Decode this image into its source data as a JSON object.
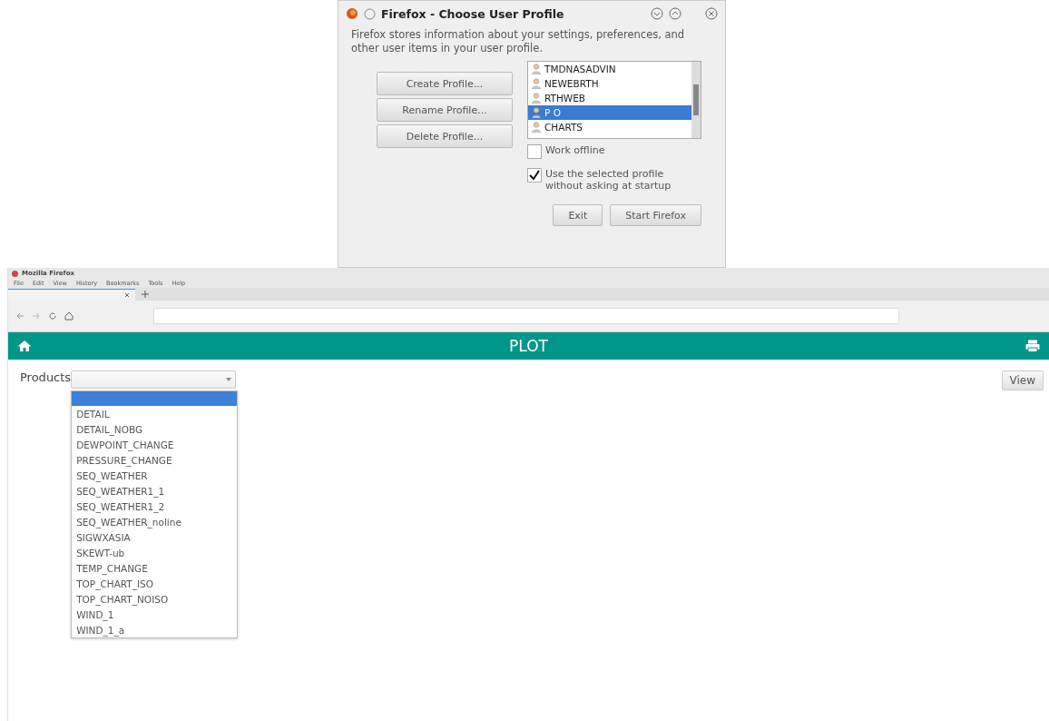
{
  "dialog": {
    "title": "Firefox - Choose User Profile",
    "message": "Firefox stores information about your settings, preferences, and other user items in your user profile.",
    "buttons": [
      "Create Profile...",
      "Rename Profile...",
      "Delete Profile..."
    ],
    "profiles": [
      {
        "name": "TMDNASADVIN",
        "selected": false
      },
      {
        "name": "NEWEBRTH",
        "selected": false
      },
      {
        "name": "RTHWEB",
        "selected": false
      },
      {
        "name": "P O",
        "selected": true
      },
      {
        "name": "CHARTS",
        "selected": false
      }
    ],
    "options": [
      {
        "label": "Work offline",
        "checked": false
      },
      {
        "label": "Use the selected profile without asking at startup",
        "checked": true
      }
    ],
    "footer_buttons": [
      "Exit",
      "Start Firefox"
    ]
  },
  "browser": {
    "title": "Mozilla Firefox",
    "menu": [
      "File",
      "Edit",
      "View",
      "History",
      "Bookmarks",
      "Tools",
      "Help"
    ]
  },
  "app": {
    "title": "PLOT",
    "products_label": "Products",
    "view_button": "View",
    "blank_option_selected": true,
    "products": [
      "DETAIL",
      "DETAIL_NOBG",
      "DEWPOINT_CHANGE",
      "PRESSURE_CHANGE",
      "SEQ_WEATHER",
      "SEQ_WEATHER1_1",
      "SEQ_WEATHER1_2",
      "SEQ_WEATHER_noline",
      "SIGWXASIA",
      "SKEWT-ub",
      "TEMP_CHANGE",
      "TOP_CHART_ISO",
      "TOP_CHART_NOISO",
      "WIND_1",
      "WIND_1_a"
    ]
  }
}
